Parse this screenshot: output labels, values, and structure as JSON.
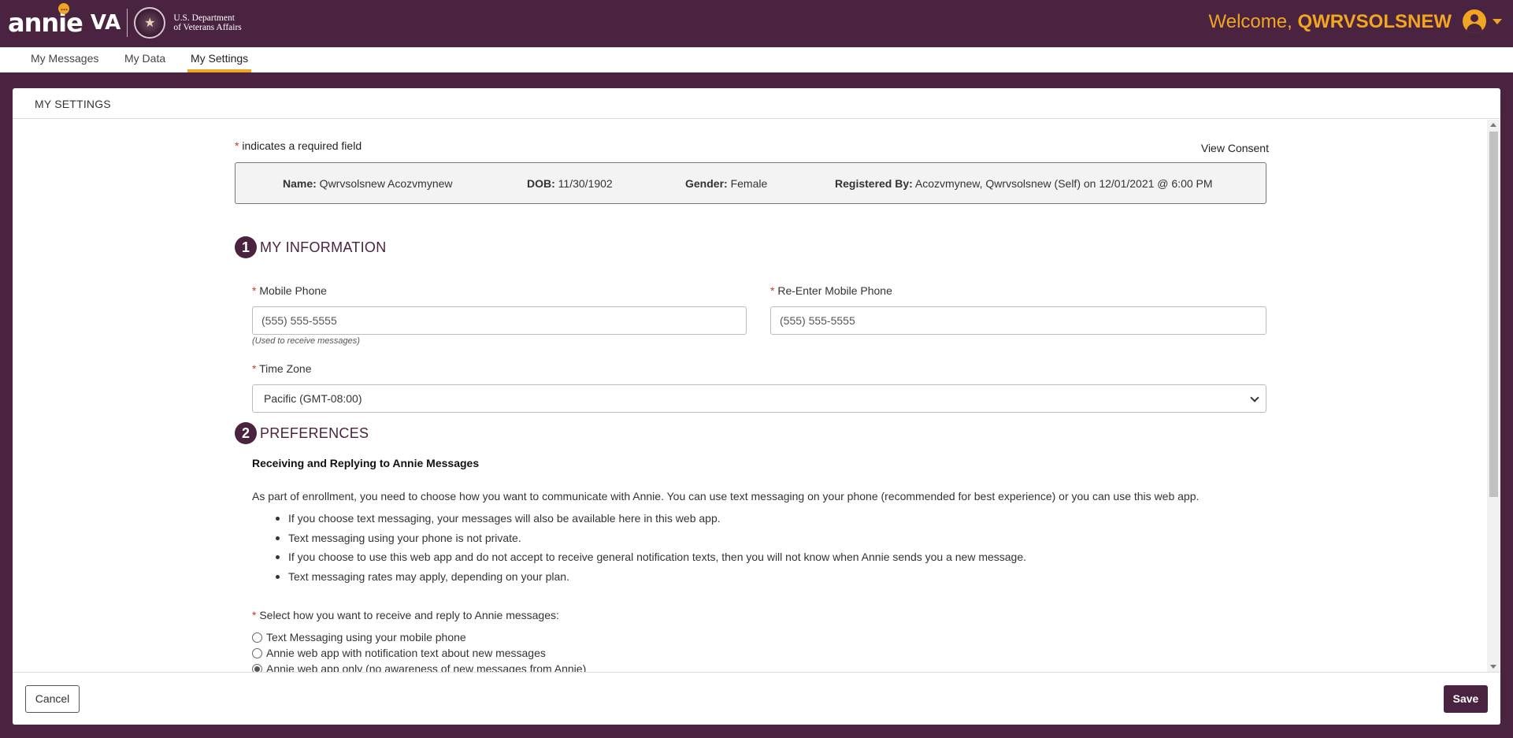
{
  "header": {
    "logo_text": "annie",
    "logo_va": "VA",
    "dept_line1": "U.S. Department",
    "dept_line2": "of Veterans Affairs",
    "welcome_prefix": "Welcome, ",
    "username": "QWRVSOLSNEW",
    "user_icon": "user-circle-icon"
  },
  "nav": {
    "tabs": [
      {
        "label": "My Messages"
      },
      {
        "label": "My Data"
      },
      {
        "label": "My Settings",
        "active": true
      }
    ]
  },
  "panel": {
    "title": "MY SETTINGS",
    "required_marker": "*",
    "required_note": " indicates a required field",
    "view_consent": "View Consent",
    "info": {
      "name_label": "Name:",
      "name_value": " Qwrvsolsnew Acozvmynew",
      "dob_label": "DOB:",
      "dob_value": " 11/30/1902",
      "gender_label": "Gender:",
      "gender_value": " Female",
      "registered_label": "Registered By:",
      "registered_value": " Acozvmynew, Qwrvsolsnew (Self) on 12/01/2021 @ 6:00 PM"
    },
    "section1": {
      "number": "1",
      "title": "MY INFORMATION",
      "mobile_label": " Mobile Phone",
      "mobile_value": "(555) 555-5555",
      "mobile_hint": "(Used to receive messages)",
      "reenter_label": " Re-Enter Mobile Phone",
      "reenter_value": "(555) 555-5555",
      "timezone_label": " Time Zone",
      "timezone_value": "Pacific (GMT-08:00)"
    },
    "section2": {
      "number": "2",
      "title": "PREFERENCES",
      "subhead": "Receiving and Replying to Annie Messages",
      "intro": "As part of enrollment, you need to choose how you want to communicate with Annie. You can use text messaging on your phone (recommended for best experience) or you can use this web app.",
      "bullets": [
        "If you choose text messaging, your messages will also be available here in this web app.",
        "Text messaging using your phone is not private.",
        "If you choose to use this web app and do not accept to receive general notification texts, then you will not know when Annie sends you a new message.",
        "Text messaging rates may apply, depending on your plan."
      ],
      "select_prompt": " Select how you want to receive and reply to Annie messages:",
      "options": [
        {
          "label": "Text Messaging using your mobile phone",
          "checked": false
        },
        {
          "label": "Annie web app with notification text about new messages",
          "checked": false
        },
        {
          "label": "Annie web app only (no awareness of new messages from Annie)",
          "checked": true
        }
      ]
    }
  },
  "footer": {
    "cancel_label": "Cancel",
    "save_label": "Save"
  },
  "colors": {
    "brand": "#4a2340",
    "accent": "#f2a520"
  }
}
